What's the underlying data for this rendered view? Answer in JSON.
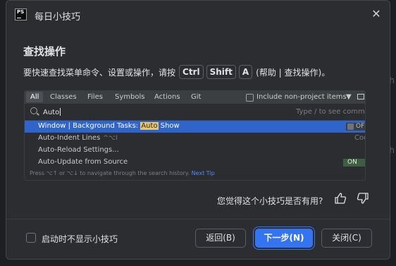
{
  "dialog": {
    "title": "每日小技巧",
    "close_glyph": "✕",
    "app_icon_text": "PS"
  },
  "tip": {
    "heading": "查找操作",
    "text_before": "要快速查找菜单命令、设置或操作，请按",
    "keys": [
      "Ctrl",
      "Shift",
      "A"
    ],
    "text_after": "(帮助 | 查找操作)。"
  },
  "embedded": {
    "tabs": [
      "All",
      "Classes",
      "Files",
      "Symbols",
      "Actions",
      "Git"
    ],
    "include_non_project_label": "Include non-project items",
    "search_value": "Auto",
    "search_hint": "Type / to see command",
    "results": [
      {
        "before": "Window | Background Tasks: ",
        "highlight": "Auto",
        "after": " Show",
        "toggle": "OFF"
      },
      {
        "label": "Auto-Indent Lines",
        "shortcut": "^⌥I",
        "right": "Code"
      },
      {
        "label": "Auto-Reload Settings..."
      },
      {
        "label": "Auto-Update from Source",
        "toggle": "ON"
      }
    ],
    "status_text": "Press ⌥↑ or ⌥↓ to navigate through the search history.",
    "status_link": "Next Tip"
  },
  "feedback": {
    "question": "您觉得这个小技巧是否有用?",
    "thumbs_up_icon": "thumbs-up",
    "thumbs_down_icon": "thumbs-down"
  },
  "footer": {
    "dont_show_label": "启动时不显示小技巧",
    "back_label": "返回(B)",
    "next_label": "下一步(N)",
    "close_label": "关闭(C)"
  },
  "background": {
    "letters": [
      "h",
      "h"
    ]
  },
  "colors": {
    "accent": "#3574f0",
    "selection": "#2f65ca",
    "highlight": "#e8c46b",
    "dialog_bg": "#2b2d30"
  }
}
